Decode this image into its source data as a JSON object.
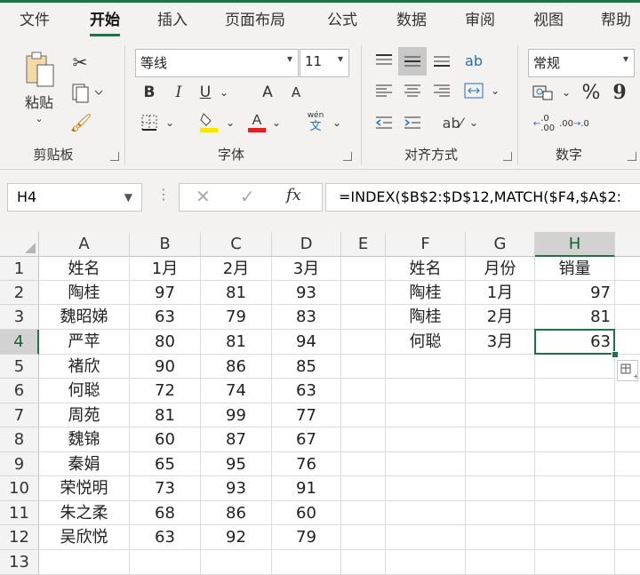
{
  "tabs": [
    "文件",
    "开始",
    "插入",
    "页面布局",
    "公式",
    "数据",
    "审阅",
    "视图",
    "帮助"
  ],
  "active_tab": "开始",
  "ribbon": {
    "clipboard": {
      "paste_label": "粘贴",
      "group_label": "剪贴板"
    },
    "font": {
      "font_name": "等线",
      "font_size": "11",
      "group_label": "字体",
      "bold": "B",
      "italic": "I",
      "underline": "U",
      "grow": "A",
      "shrink": "A",
      "phonetic_top": "wén",
      "phonetic_bottom": "文"
    },
    "alignment": {
      "group_label": "对齐方式"
    },
    "number": {
      "format": "常规",
      "group_label": "数字",
      "percent": "%",
      "comma": "9"
    }
  },
  "formula_bar": {
    "name_box": "H4",
    "formula": "=INDEX($B$2:$D$12,MATCH($F4,$A$2:"
  },
  "columns": [
    "A",
    "B",
    "C",
    "D",
    "E",
    "F",
    "G",
    "H"
  ],
  "rows": [
    "1",
    "2",
    "3",
    "4",
    "5",
    "6",
    "7",
    "8",
    "9",
    "10",
    "11",
    "12",
    "13"
  ],
  "table_left": [
    [
      "姓名",
      "1月",
      "2月",
      "3月"
    ],
    [
      "陶桂",
      "97",
      "81",
      "93"
    ],
    [
      "魏昭娣",
      "63",
      "79",
      "83"
    ],
    [
      "严苹",
      "80",
      "81",
      "94"
    ],
    [
      "褚欣",
      "90",
      "86",
      "85"
    ],
    [
      "何聪",
      "72",
      "74",
      "63"
    ],
    [
      "周苑",
      "81",
      "99",
      "77"
    ],
    [
      "魏锦",
      "60",
      "87",
      "67"
    ],
    [
      "秦娟",
      "65",
      "95",
      "76"
    ],
    [
      "荣悦明",
      "73",
      "93",
      "91"
    ],
    [
      "朱之柔",
      "68",
      "86",
      "60"
    ],
    [
      "吴欣悦",
      "63",
      "92",
      "79"
    ]
  ],
  "table_right": [
    [
      "姓名",
      "月份",
      "销量"
    ],
    [
      "陶桂",
      "1月",
      "97"
    ],
    [
      "陶桂",
      "2月",
      "81"
    ],
    [
      "何聪",
      "3月",
      "63"
    ]
  ],
  "selected_cell": "H4",
  "colors": {
    "accent": "#217346",
    "font_color": "#e02020",
    "highlight": "#ffe600"
  }
}
